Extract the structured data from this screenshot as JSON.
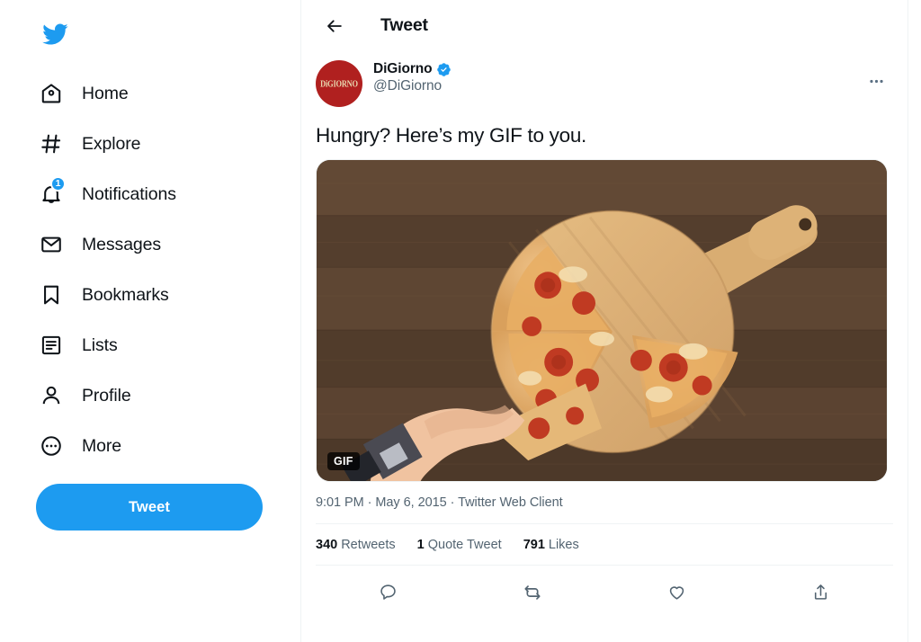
{
  "sidebar": {
    "logo_icon": "twitter-bird-icon",
    "items": [
      {
        "label": "Home",
        "icon": "home-icon",
        "badge": ""
      },
      {
        "label": "Explore",
        "icon": "hashtag-icon",
        "badge": ""
      },
      {
        "label": "Notifications",
        "icon": "bell-icon",
        "badge": "1"
      },
      {
        "label": "Messages",
        "icon": "envelope-icon",
        "badge": ""
      },
      {
        "label": "Bookmarks",
        "icon": "bookmark-icon",
        "badge": ""
      },
      {
        "label": "Lists",
        "icon": "list-icon",
        "badge": ""
      },
      {
        "label": "Profile",
        "icon": "person-icon",
        "badge": ""
      },
      {
        "label": "More",
        "icon": "ellipsis-circle-icon",
        "badge": ""
      }
    ],
    "tweet_button_label": "Tweet"
  },
  "topbar": {
    "back_icon": "back-arrow-icon",
    "title": "Tweet"
  },
  "tweet": {
    "author_name": "DiGiorno",
    "author_handle": "@DiGiorno",
    "verified_icon": "verified-badge-icon",
    "avatar_text": "DiGIORNO",
    "more_icon": "ellipsis-horizontal-icon",
    "text": "Hungry? Here’s my GIF to you.",
    "media": {
      "badge_label": "GIF",
      "description": "Overhead view of a pepperoni pizza on a round wooden paddle board with a hand taking a slice, on a dark brown wood table"
    },
    "timestamp": "9:01 PM · May 6, 2015 · Twitter Web Client",
    "stats": [
      {
        "count": "340",
        "label": "Retweets"
      },
      {
        "count": "1",
        "label": "Quote Tweet"
      },
      {
        "count": "791",
        "label": "Likes"
      }
    ],
    "actions": [
      {
        "icon": "reply-icon"
      },
      {
        "icon": "retweet-icon"
      },
      {
        "icon": "like-heart-icon"
      },
      {
        "icon": "share-icon"
      }
    ]
  },
  "colors": {
    "accent": "#1d9bf0",
    "text_primary": "#0f1419",
    "text_secondary": "#536471",
    "border": "#eff3f4",
    "avatar_bg": "#b0201f"
  }
}
